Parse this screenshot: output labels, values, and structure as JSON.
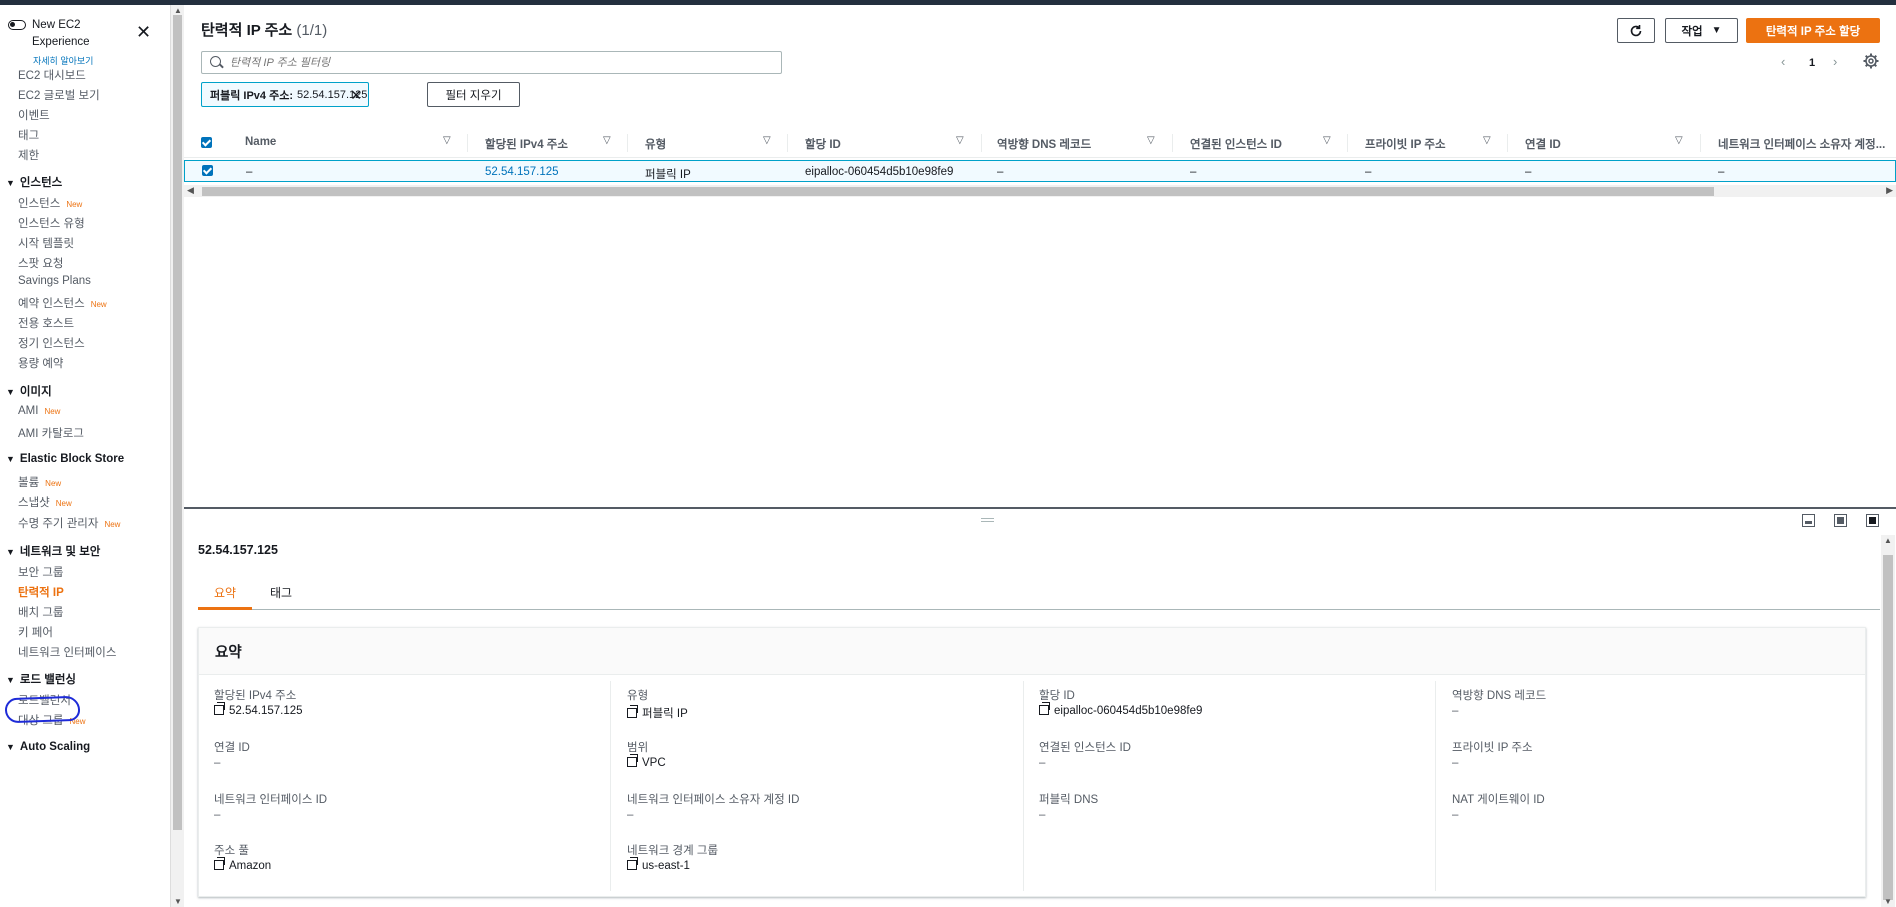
{
  "sidebar": {
    "experience_title": "New EC2 Experience",
    "learn_more": "자세히 알아보기",
    "top_items": [
      "EC2 대시보드",
      "EC2 글로벌 보기",
      "이벤트",
      "태그",
      "제한"
    ],
    "sections": [
      {
        "title": "인스턴스",
        "items": [
          {
            "label": "인스턴스",
            "new": "New"
          },
          {
            "label": "인스턴스 유형",
            "new": ""
          },
          {
            "label": "시작 템플릿",
            "new": ""
          },
          {
            "label": "스팟 요청",
            "new": ""
          },
          {
            "label": "Savings Plans",
            "new": ""
          },
          {
            "label": "예약 인스턴스",
            "new": "New"
          },
          {
            "label": "전용 호스트",
            "new": ""
          },
          {
            "label": "정기 인스턴스",
            "new": ""
          },
          {
            "label": "용량 예약",
            "new": ""
          }
        ]
      },
      {
        "title": "이미지",
        "items": [
          {
            "label": "AMI",
            "new": "New"
          },
          {
            "label": "AMI 카탈로그",
            "new": ""
          }
        ]
      },
      {
        "title": "Elastic Block Store",
        "items": [
          {
            "label": "볼륨",
            "new": "New"
          },
          {
            "label": "스냅샷",
            "new": "New"
          },
          {
            "label": "수명 주기 관리자",
            "new": "New"
          }
        ]
      },
      {
        "title": "네트워크 및 보안",
        "items": [
          {
            "label": "보안 그룹",
            "new": ""
          },
          {
            "label": "탄력적 IP",
            "new": ""
          },
          {
            "label": "배치 그룹",
            "new": ""
          },
          {
            "label": "키 페어",
            "new": ""
          },
          {
            "label": "네트워크 인터페이스",
            "new": ""
          }
        ]
      },
      {
        "title": "로드 밸런싱",
        "items": [
          {
            "label": "로드밸런서",
            "new": ""
          },
          {
            "label": "대상 그룹",
            "new": "New"
          }
        ]
      },
      {
        "title": "Auto Scaling",
        "items": []
      }
    ]
  },
  "header": {
    "title": "탄력적 IP 주소",
    "count": "(1/1)",
    "actions_label": "작업",
    "allocate_label": "탄력적 IP 주소 할당",
    "search_placeholder": "탄력적 IP 주소 필터링",
    "page_number": "1"
  },
  "filter": {
    "token_key": "퍼블릭 IPv4 주소:",
    "token_value": "52.54.157.125",
    "clear_label": "필터 지우기"
  },
  "table": {
    "columns": [
      "Name",
      "할당된 IPv4 주소",
      "유형",
      "할당 ID",
      "역방향 DNS 레코드",
      "연결된 인스턴스 ID",
      "프라이빗 IP 주소",
      "연결 ID",
      "네트워크 인터페이스 소유자 계정..."
    ],
    "rows": [
      [
        "–",
        "52.54.157.125",
        "퍼블릭 IP",
        "eipalloc-060454d5b10e98fe9",
        "–",
        "–",
        "–",
        "–",
        "–"
      ]
    ]
  },
  "details": {
    "title": "52.54.157.125",
    "tabs": [
      "요약",
      "태그"
    ],
    "card_title": "요약",
    "fields": [
      {
        "label": "할당된 IPv4 주소",
        "value": "52.54.157.125",
        "copy": true
      },
      {
        "label": "유형",
        "value": "퍼블릭 IP",
        "copy": true
      },
      {
        "label": "할당 ID",
        "value": "eipalloc-060454d5b10e98fe9",
        "copy": true
      },
      {
        "label": "역방향 DNS 레코드",
        "value": "–",
        "copy": false
      },
      {
        "label": "연결 ID",
        "value": "–",
        "copy": false
      },
      {
        "label": "범위",
        "value": "VPC",
        "copy": true
      },
      {
        "label": "연결된 인스턴스 ID",
        "value": "–",
        "copy": false
      },
      {
        "label": "프라이빗 IP 주소",
        "value": "–",
        "copy": false
      },
      {
        "label": "네트워크 인터페이스 ID",
        "value": "–",
        "copy": false
      },
      {
        "label": "네트워크 인터페이스 소유자 계정 ID",
        "value": "–",
        "copy": false
      },
      {
        "label": "퍼블릭 DNS",
        "value": "–",
        "copy": false
      },
      {
        "label": "NAT 게이트웨이 ID",
        "value": "–",
        "copy": false
      },
      {
        "label": "주소 풀",
        "value": "Amazon",
        "copy": true
      },
      {
        "label": "네트워크 경계 그룹",
        "value": "us-east-1",
        "copy": true
      }
    ]
  },
  "colors": {
    "accent": "#ec7211",
    "link": "#0073bb",
    "selected_border": "#00a1c9",
    "annotation": "#1e2bd8"
  }
}
